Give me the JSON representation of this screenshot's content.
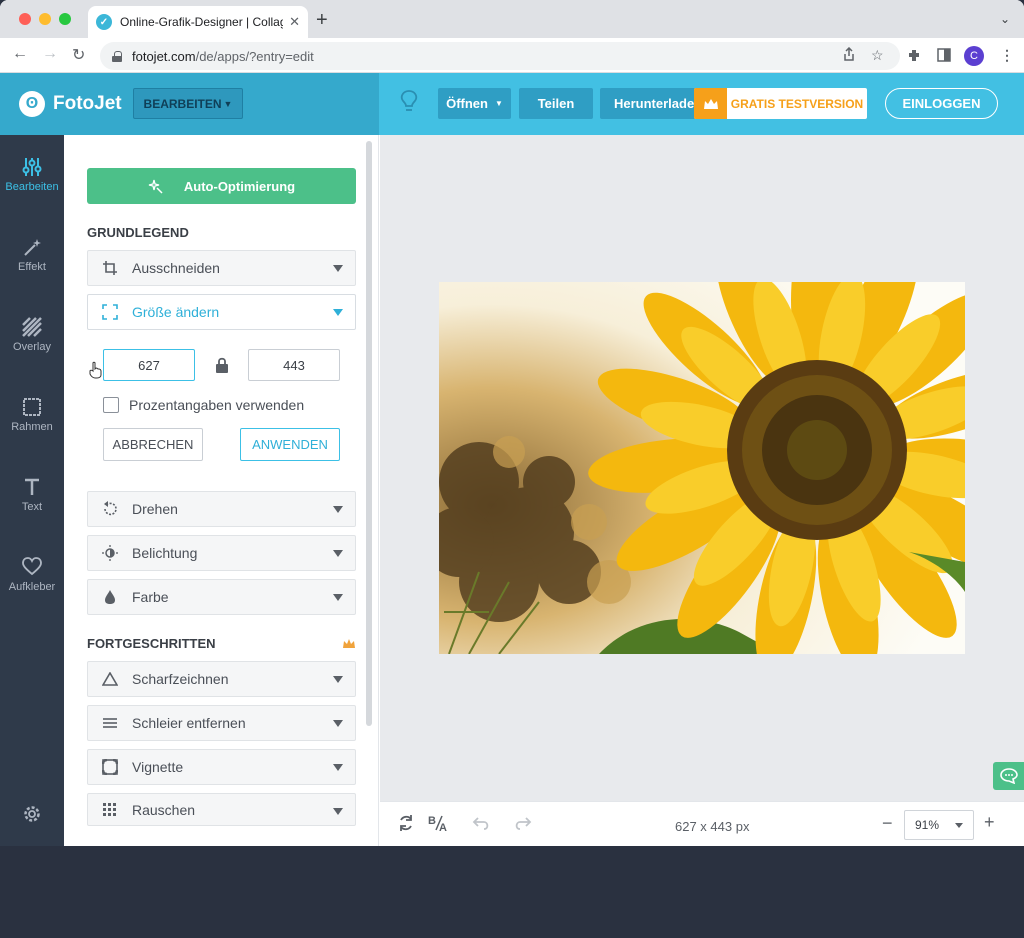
{
  "browser": {
    "tab_title": "Online-Grafik-Designer | Collag",
    "url_host": "fotojet.com",
    "url_path": "/de/apps/?entry=edit",
    "avatar_letter": "C"
  },
  "header": {
    "logo_text": "FotoJet",
    "mode_label": "BEARBEITEN",
    "open_label": "Öffnen",
    "share_label": "Teilen",
    "download_label": "Herunterladen",
    "trial_label": "GRATIS TESTVERSION",
    "login_label": "EINLOGGEN"
  },
  "rail": {
    "items": [
      {
        "label": "Bearbeiten",
        "icon": "sliders-icon"
      },
      {
        "label": "Effekt",
        "icon": "magic-wand-icon"
      },
      {
        "label": "Overlay",
        "icon": "stripes-icon"
      },
      {
        "label": "Rahmen",
        "icon": "frame-icon"
      },
      {
        "label": "Text",
        "icon": "text-icon"
      },
      {
        "label": "Aufkleber",
        "icon": "heart-icon"
      }
    ]
  },
  "panel": {
    "auto_label": "Auto-Optimierung",
    "basic_title": "GRUNDLEGEND",
    "crop_label": "Ausschneiden",
    "resize_label": "Größe ändern",
    "width_value": "627",
    "height_value": "443",
    "percent_label": "Prozentangaben verwenden",
    "cancel_label": "ABBRECHEN",
    "apply_label": "ANWENDEN",
    "rotate_label": "Drehen",
    "exposure_label": "Belichtung",
    "color_label": "Farbe",
    "advanced_title": "FORTGESCHRITTEN",
    "sharpen_label": "Scharfzeichnen",
    "dehaze_label": "Schleier entfernen",
    "vignette_label": "Vignette",
    "noise_label": "Rauschen"
  },
  "canvas": {
    "size_label": "627 x 443 px",
    "zoom_value": "91%"
  },
  "colors": {
    "brand": "#42c0e3",
    "accent_green": "#4cc089",
    "trial_orange": "#f6a01a"
  }
}
